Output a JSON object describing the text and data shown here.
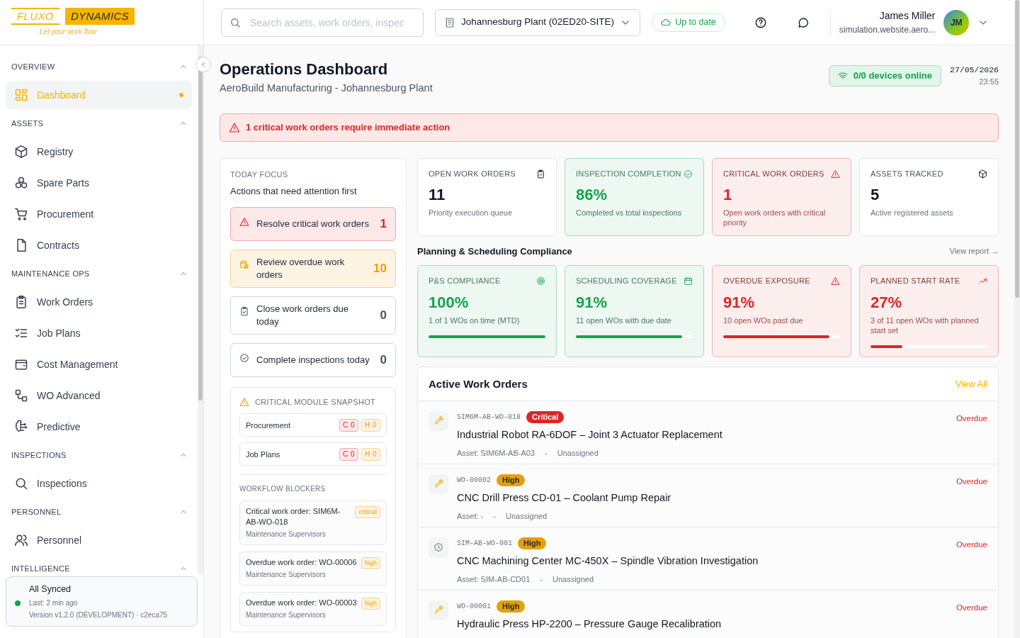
{
  "brand": {
    "name_left": "FLUXO",
    "name_right": "DYNAMICS",
    "tagline": "Let your work flow"
  },
  "sidebar": {
    "sections": [
      {
        "title": "OVERVIEW",
        "expanded": true,
        "items": [
          {
            "label": "Dashboard",
            "selected": true
          }
        ]
      },
      {
        "title": "ASSETS",
        "expanded": true,
        "items": [
          {
            "label": "Registry",
            "selected": false
          },
          {
            "label": "Spare Parts",
            "selected": false
          },
          {
            "label": "Procurement",
            "selected": false
          },
          {
            "label": "Contracts",
            "selected": false
          }
        ]
      },
      {
        "title": "MAINTENANCE OPS",
        "expanded": true,
        "items": [
          {
            "label": "Work Orders",
            "selected": false
          },
          {
            "label": "Job Plans",
            "selected": false
          },
          {
            "label": "Cost Management",
            "selected": false
          },
          {
            "label": "WO Advanced",
            "selected": false
          },
          {
            "label": "Predictive",
            "selected": false
          }
        ]
      },
      {
        "title": "INSPECTIONS",
        "expanded": true,
        "items": [
          {
            "label": "Inspections",
            "selected": false
          }
        ]
      },
      {
        "title": "PERSONNEL",
        "expanded": true,
        "items": [
          {
            "label": "Personnel",
            "selected": false
          }
        ]
      },
      {
        "title": "INTELLIGENCE",
        "expanded": true
      }
    ],
    "sync": {
      "title": "All Synced",
      "last": "Last: 2 min ago",
      "version": "Version v1.2.0 (DEVELOPMENT) · c2eca75"
    }
  },
  "topbar": {
    "search": {
      "placeholder": "Search assets, work orders, inspec"
    },
    "site": "Johannesburg Plant (02ED20-SITE)",
    "sync_badge": "Up to date",
    "user": {
      "name": "James Miller",
      "email": "simulation.website.aero...",
      "initials": "JM"
    }
  },
  "header": {
    "title": "Operations Dashboard",
    "subtitle": "AeroBuild Manufacturing - Johannesburg Plant",
    "devices": "0/0 devices online",
    "date": "27/05/2026",
    "time": "23:55"
  },
  "alert": "1 critical work orders require immediate action",
  "focus": {
    "label": "TODAY FOCUS",
    "subtitle": "Actions that need attention first",
    "items": [
      {
        "kind": "critical",
        "label": "Resolve critical work orders",
        "count": "1"
      },
      {
        "kind": "overdue",
        "label": "Review overdue work orders",
        "count": "10"
      },
      {
        "kind": "due",
        "label": "Close work orders due today",
        "count": "0"
      },
      {
        "kind": "inspection",
        "label": "Complete inspections today",
        "count": "0"
      }
    ]
  },
  "snapshot": {
    "title": "CRITICAL MODULE SNAPSHOT",
    "modules": [
      {
        "name": "Procurement",
        "critical": "C 0",
        "high": "H 0"
      },
      {
        "name": "Job Plans",
        "critical": "C 0",
        "high": "H 0"
      }
    ],
    "blockers_title": "WORKFLOW BLOCKERS",
    "blockers": [
      {
        "title": "Critical work order: SIM6M-AB-WO-018",
        "team": "Maintenance Supervisors",
        "priority": "critical"
      },
      {
        "title": "Overdue work order: WO-00006",
        "team": "Maintenance Supervisors",
        "priority": "high"
      },
      {
        "title": "Overdue work order: WO-00003",
        "team": "Maintenance Supervisors",
        "priority": "high"
      }
    ]
  },
  "kpis": [
    {
      "kind": "neutral",
      "title": "OPEN WORK ORDERS",
      "value": "11",
      "caption": "Priority execution queue"
    },
    {
      "kind": "green",
      "title": "INSPECTION COMPLETION",
      "value": "86%",
      "caption": "Completed vs total inspections"
    },
    {
      "kind": "red",
      "title": "CRITICAL WORK ORDERS",
      "value": "1",
      "caption": "Open work orders with critical priority"
    },
    {
      "kind": "neutral",
      "title": "ASSETS TRACKED",
      "value": "5",
      "caption": "Active registered assets"
    }
  ],
  "compliance": {
    "title": "Planning & Scheduling Compliance",
    "link": "View report →",
    "cards": [
      {
        "kind": "green",
        "title": "P&S COMPLIANCE",
        "value": "100%",
        "caption": "1 of 1 WOs on time (MTD)",
        "level": 1
      },
      {
        "kind": "green",
        "title": "SCHEDULING COVERAGE",
        "value": "91%",
        "caption": "11 open WOs with due date",
        "level": 0.91
      },
      {
        "kind": "red",
        "title": "OVERDUE EXPOSURE",
        "value": "91%",
        "caption": "10 open WOs past due",
        "level": 0.91
      },
      {
        "kind": "red",
        "title": "PLANNED START RATE",
        "value": "27%",
        "caption": "3 of 11 open WOs with planned start set",
        "level": 0.27
      }
    ]
  },
  "work_orders": {
    "title": "Active Work Orders",
    "view_all": "View All",
    "items": [
      {
        "kind": "wrench",
        "code": "SIM6M-AB-WO-018",
        "priority": "Critical",
        "color": "#dc2626",
        "title": "Industrial Robot RA-6DOF – Joint 3 Actuator Replacement",
        "asset": "Asset: SIM6M-AB-A03",
        "separator": "-",
        "assignee": "Unassigned",
        "status": "Overdue"
      },
      {
        "kind": "wrench",
        "code": "WO-00002",
        "priority": "High",
        "color": "#e6a00a",
        "title": "CNC Drill Press CD-01 – Coolant Pump Repair",
        "asset": "Asset: -",
        "separator": "-",
        "assignee": "Unassigned",
        "status": "Overdue"
      },
      {
        "kind": "clock",
        "code": "SIM-AB-WO-001",
        "priority": "High",
        "color": "#e6a00a",
        "title": "CNC Machining Center MC-450X – Spindle Vibration Investigation",
        "asset": "Asset: SIM-AB-CD01",
        "separator": "-",
        "assignee": "Unassigned",
        "status": "Overdue"
      },
      {
        "kind": "wrench",
        "code": "WO-00001",
        "priority": "High",
        "color": "#e6a00a",
        "title": "Hydraulic Press HP-2200 – Pressure Gauge Recalibration",
        "status": "Overdue"
      }
    ]
  }
}
